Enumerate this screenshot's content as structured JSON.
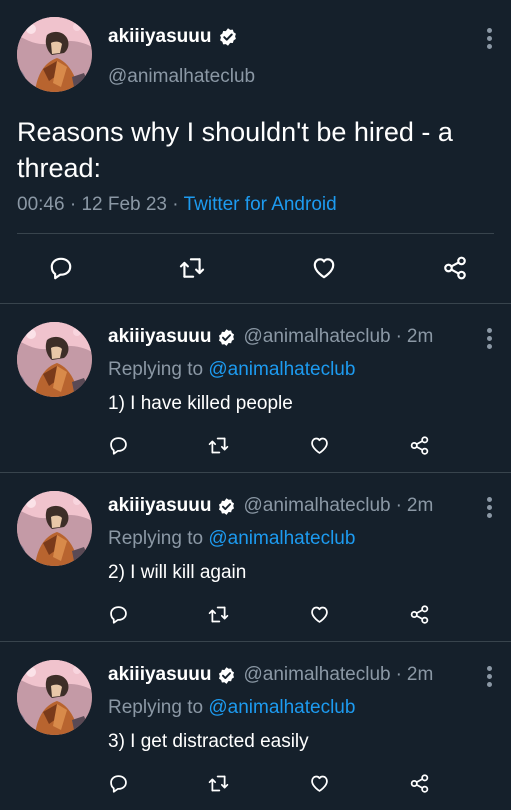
{
  "colors": {
    "background": "#15202b",
    "text": "#ffffff",
    "muted": "#8b98a5",
    "link": "#1d9bf0",
    "divider": "#38444d"
  },
  "main_tweet": {
    "display_name": "akiiiyasuuu",
    "handle": "@animalhateclub",
    "text": "Reasons why I shouldn't be hired - a thread:",
    "time": "00:46",
    "date": "12 Feb 23",
    "source": "Twitter for Android",
    "icons": [
      "more-icon",
      "verified-icon",
      "reply-icon",
      "retweet-icon",
      "like-icon",
      "share-icon"
    ]
  },
  "replies": [
    {
      "display_name": "akiiiyasuuu",
      "handle": "@animalhateclub",
      "time": "2m",
      "replying_label": "Replying to",
      "replying_to": "@animalhateclub",
      "text": "1) I have killed people"
    },
    {
      "display_name": "akiiiyasuuu",
      "handle": "@animalhateclub",
      "time": "2m",
      "replying_label": "Replying to",
      "replying_to": "@animalhateclub",
      "text": "2) I will kill again"
    },
    {
      "display_name": "akiiiyasuuu",
      "handle": "@animalhateclub",
      "time": "2m",
      "replying_label": "Replying to",
      "replying_to": "@animalhateclub",
      "text": "3) I get distracted easily"
    }
  ],
  "separators": {
    "dot": "·"
  }
}
